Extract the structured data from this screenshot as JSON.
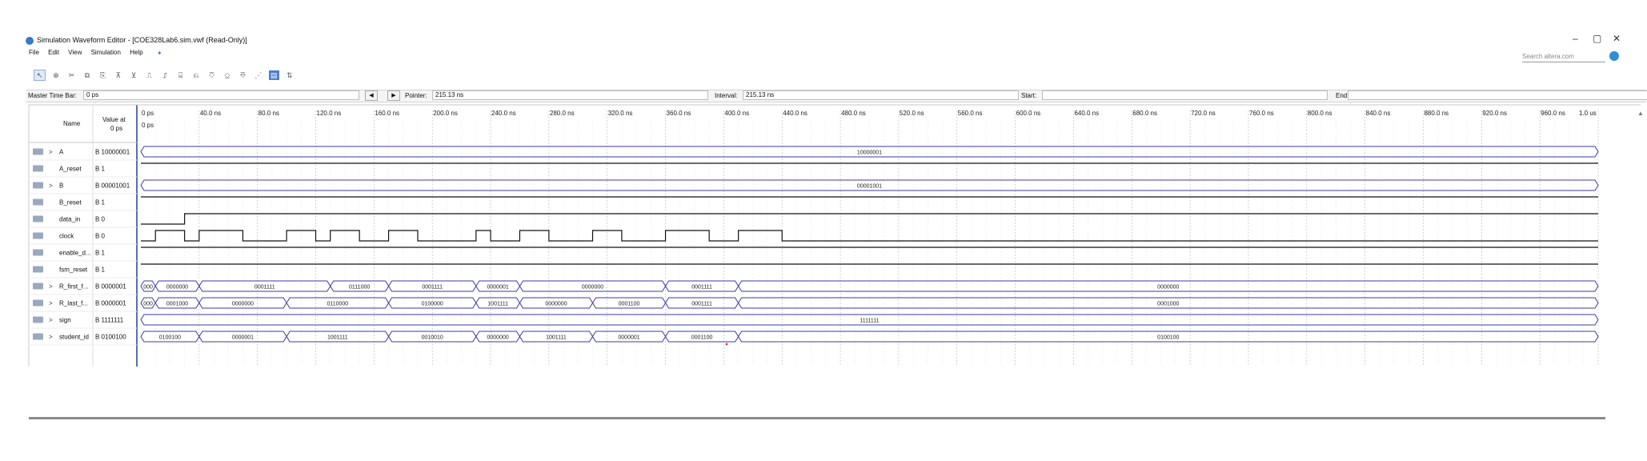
{
  "window": {
    "title": "Simulation Waveform Editor - [COE328Lab6.sim.vwf (Read-Only)]",
    "controls": [
      "–",
      "▢",
      "✕"
    ]
  },
  "menu": [
    "File",
    "Edit",
    "View",
    "Simulation",
    "Help"
  ],
  "search": {
    "placeholder": "Search altera.com"
  },
  "toolbar_icons": [
    "pointer-icon",
    "zoom-icon",
    "cut-icon",
    "copy-icon",
    "paste-icon",
    "insert-icon",
    "overwrite-icon",
    "waveform-icon",
    "invert-icon",
    "count-icon",
    "group-icon",
    "random-icon",
    "clock-icon",
    "xor-icon",
    "snap-icon",
    "radix-icon"
  ],
  "timebar": {
    "master_label": "Master Time Bar:",
    "master_value": "0 ps",
    "pointer_label": "Pointer:",
    "pointer_value": "215.13 ns",
    "interval_label": "Interval:",
    "interval_value": "215.13 ns",
    "start_label": "Start:",
    "start_value": "",
    "end_label": "End:",
    "end_value": ""
  },
  "columns": {
    "name": "Name",
    "value_at": "Value at",
    "value_time": "0 ps"
  },
  "time_axis": {
    "ticks": [
      "0 ps",
      "40.0 ns",
      "80.0 ns",
      "120.0 ns",
      "160.0 ns",
      "200.0 ns",
      "240.0 ns",
      "280.0 ns",
      "320.0 ns",
      "360.0 ns",
      "400.0 ns",
      "440.0 ns",
      "480.0 ns",
      "520.0 ns",
      "560.0 ns",
      "600.0 ns",
      "640.0 ns",
      "680.0 ns",
      "720.0 ns",
      "760.0 ns",
      "800.0 ns",
      "840.0 ns",
      "880.0 ns",
      "920.0 ns",
      "960.0 ns",
      "1.0 us"
    ],
    "cursor_label": "0 ps",
    "max_ns": 1000
  },
  "signals": [
    {
      "name": "A",
      "value": "B 10000001",
      "bus": true,
      "segments": [
        {
          "start": 0,
          "end": 1000,
          "label": "10000001"
        }
      ]
    },
    {
      "name": "A_reset",
      "value": "B 1",
      "bus": false,
      "transitions": [
        [
          0,
          1
        ]
      ]
    },
    {
      "name": "B",
      "value": "B 00001001",
      "bus": true,
      "segments": [
        {
          "start": 0,
          "end": 1000,
          "label": "00001001"
        }
      ]
    },
    {
      "name": "B_reset",
      "value": "B 1",
      "bus": false,
      "transitions": [
        [
          0,
          1
        ]
      ]
    },
    {
      "name": "data_in",
      "value": "B 0",
      "bus": false,
      "transitions": [
        [
          0,
          0
        ],
        [
          30,
          1
        ]
      ]
    },
    {
      "name": "clock",
      "value": "B 0",
      "bus": false,
      "transitions": [
        [
          0,
          0
        ],
        [
          10,
          1
        ],
        [
          30,
          0
        ],
        [
          40,
          1
        ],
        [
          70,
          0
        ],
        [
          100,
          1
        ],
        [
          120,
          0
        ],
        [
          130,
          1
        ],
        [
          150,
          0
        ],
        [
          170,
          1
        ],
        [
          190,
          0
        ],
        [
          230,
          1
        ],
        [
          240,
          0
        ],
        [
          260,
          1
        ],
        [
          280,
          0
        ],
        [
          310,
          1
        ],
        [
          330,
          0
        ],
        [
          360,
          1
        ],
        [
          390,
          0
        ],
        [
          410,
          1
        ],
        [
          440,
          0
        ]
      ]
    },
    {
      "name": "enable_d...",
      "value": "B 1",
      "bus": false,
      "transitions": [
        [
          0,
          1
        ]
      ]
    },
    {
      "name": "fsm_reset",
      "value": "B 1",
      "bus": false,
      "transitions": [
        [
          0,
          1
        ]
      ]
    },
    {
      "name": "R_first_f...",
      "value": "B 0000001",
      "bus": true,
      "segments": [
        {
          "start": 0,
          "end": 10,
          "label": "000"
        },
        {
          "start": 10,
          "end": 40,
          "label": "0000000"
        },
        {
          "start": 40,
          "end": 130,
          "label": "0001111"
        },
        {
          "start": 130,
          "end": 170,
          "label": "0111000"
        },
        {
          "start": 170,
          "end": 230,
          "label": "0001111"
        },
        {
          "start": 230,
          "end": 260,
          "label": "0000001"
        },
        {
          "start": 260,
          "end": 360,
          "label": "0000000"
        },
        {
          "start": 360,
          "end": 410,
          "label": "0001111"
        },
        {
          "start": 410,
          "end": 1000,
          "label": "0000000"
        }
      ]
    },
    {
      "name": "R_last_f...",
      "value": "B 0000001",
      "bus": true,
      "segments": [
        {
          "start": 0,
          "end": 10,
          "label": "000"
        },
        {
          "start": 10,
          "end": 40,
          "label": "0001000"
        },
        {
          "start": 40,
          "end": 100,
          "label": "0000000"
        },
        {
          "start": 100,
          "end": 170,
          "label": "0110000"
        },
        {
          "start": 170,
          "end": 230,
          "label": "0100000"
        },
        {
          "start": 230,
          "end": 260,
          "label": "1001111"
        },
        {
          "start": 260,
          "end": 310,
          "label": "0000000"
        },
        {
          "start": 310,
          "end": 360,
          "label": "0001100"
        },
        {
          "start": 360,
          "end": 410,
          "label": "0001111"
        },
        {
          "start": 410,
          "end": 1000,
          "label": "0001000"
        }
      ]
    },
    {
      "name": "sign",
      "value": "B 1111111",
      "bus": true,
      "segments": [
        {
          "start": 0,
          "end": 1000,
          "label": "1111111"
        }
      ]
    },
    {
      "name": "student_id",
      "value": "B 0100100",
      "bus": true,
      "segments": [
        {
          "start": 0,
          "end": 40,
          "label": "0100100"
        },
        {
          "start": 40,
          "end": 100,
          "label": "0000001"
        },
        {
          "start": 100,
          "end": 170,
          "label": "1001111"
        },
        {
          "start": 170,
          "end": 230,
          "label": "0010010"
        },
        {
          "start": 230,
          "end": 260,
          "label": "0000000"
        },
        {
          "start": 260,
          "end": 310,
          "label": "1001111"
        },
        {
          "start": 310,
          "end": 360,
          "label": "0000001"
        },
        {
          "start": 360,
          "end": 410,
          "label": "0001100"
        },
        {
          "start": 410,
          "end": 1000,
          "label": "0100100"
        }
      ]
    }
  ],
  "colors": {
    "bus_outline": "#3a3aa8",
    "signal": "#111111",
    "grid": "#b8b8b8",
    "panel_border": "#5a6fb0"
  }
}
